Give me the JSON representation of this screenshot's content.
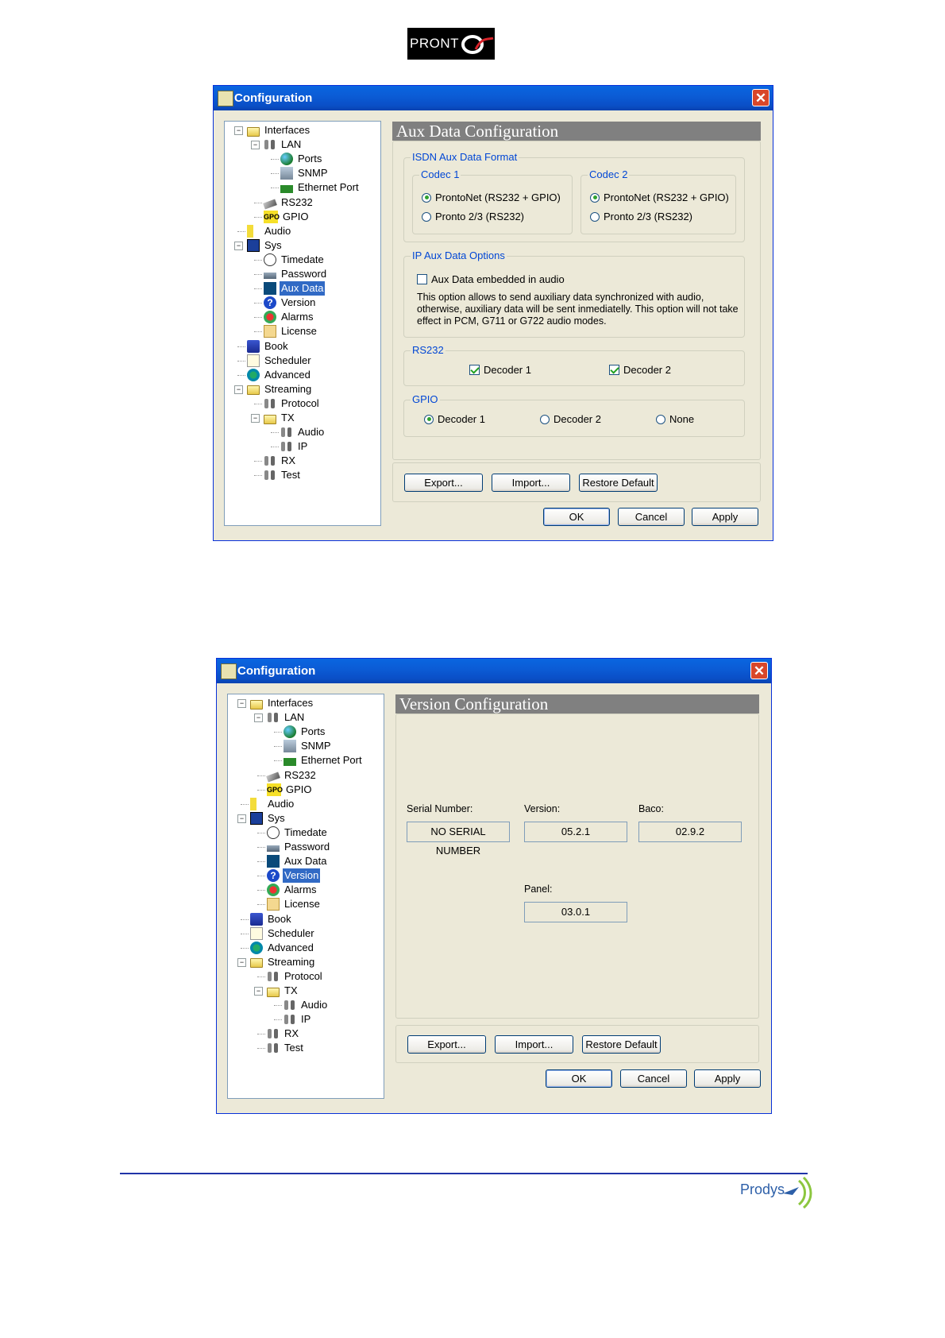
{
  "header": {
    "logo_text": "PRONT"
  },
  "window1": {
    "title": "Configuration",
    "panel_title": "Aux Data Configuration",
    "tree": [
      {
        "label": "Interfaces",
        "selected": false
      },
      {
        "label": "LAN",
        "selected": false
      },
      {
        "label": "Ports",
        "selected": false
      },
      {
        "label": "SNMP",
        "selected": false
      },
      {
        "label": "Ethernet Port",
        "selected": false
      },
      {
        "label": "RS232",
        "selected": false
      },
      {
        "label": "GPIO",
        "selected": false
      },
      {
        "label": "Audio",
        "selected": false
      },
      {
        "label": "Sys",
        "selected": false
      },
      {
        "label": "Timedate",
        "selected": false
      },
      {
        "label": "Password",
        "selected": false
      },
      {
        "label": "Aux Data",
        "selected": true
      },
      {
        "label": "Version",
        "selected": false
      },
      {
        "label": "Alarms",
        "selected": false
      },
      {
        "label": "License",
        "selected": false
      },
      {
        "label": "Book",
        "selected": false
      },
      {
        "label": "Scheduler",
        "selected": false
      },
      {
        "label": "Advanced",
        "selected": false
      },
      {
        "label": "Streaming",
        "selected": false
      },
      {
        "label": "Protocol",
        "selected": false
      },
      {
        "label": "TX",
        "selected": false
      },
      {
        "label": "Audio",
        "selected": false
      },
      {
        "label": "IP",
        "selected": false
      },
      {
        "label": "RX",
        "selected": false
      },
      {
        "label": "Test",
        "selected": false
      }
    ],
    "isdn_group": {
      "title": "ISDN Aux Data Format",
      "codec1": {
        "title": "Codec 1",
        "opt1": "ProntoNet (RS232 + GPIO)",
        "opt2": "Pronto 2/3 (RS232)",
        "selected": "opt1"
      },
      "codec2": {
        "title": "Codec 2",
        "opt1": "ProntoNet (RS232 + GPIO)",
        "opt2": "Pronto 2/3 (RS232)",
        "selected": "opt1"
      }
    },
    "ip_group": {
      "title": "IP Aux Data Options",
      "checkbox_label": "Aux Data embedded in audio",
      "checked": false,
      "description": "This option allows to send auxiliary data synchronized with audio, otherwise, auxiliary data will be sent inmediatelly. This option will not take effect in PCM, G711 or G722 audio modes."
    },
    "rs232_group": {
      "title": "RS232",
      "decoder1": "Decoder 1",
      "decoder2": "Decoder 2",
      "decoder1_checked": true,
      "decoder2_checked": true
    },
    "gpio_group": {
      "title": "GPIO",
      "opt1": "Decoder 1",
      "opt2": "Decoder 2",
      "opt3": "None",
      "selected": "opt1"
    },
    "buttons": {
      "export": "Export...",
      "import": "Import...",
      "restore": "Restore Default",
      "ok": "OK",
      "cancel": "Cancel",
      "apply": "Apply"
    }
  },
  "window2": {
    "title": "Configuration",
    "panel_title": "Version Configuration",
    "serial_label": "Serial Number:",
    "serial_value": "NO SERIAL NUMBER",
    "version_label": "Version:",
    "version_value": "05.2.1",
    "baco_label": "Baco:",
    "baco_value": "02.9.2",
    "panel_label": "Panel:",
    "panel_value": "03.0.1",
    "buttons": {
      "export": "Export...",
      "import": "Import...",
      "restore": "Restore Default",
      "ok": "OK",
      "cancel": "Cancel",
      "apply": "Apply"
    }
  },
  "footer": {
    "brand": "Prodys"
  },
  "colors": {
    "title_bar": "#0a5cd6",
    "group_title": "#0046d5",
    "rule": "#2033a8",
    "selection": "#316ac5"
  }
}
